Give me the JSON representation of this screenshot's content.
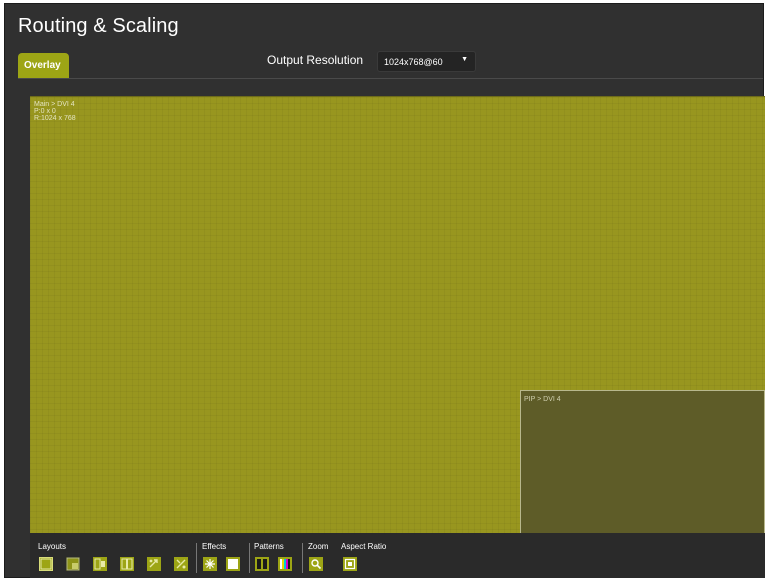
{
  "header": {
    "title": "Routing & Scaling",
    "tab_overlay": "Overlay",
    "output_resolution_label": "Output Resolution",
    "output_resolution_value": "1024x768@60"
  },
  "canvas": {
    "main_window": {
      "source": "Main > DVI 4",
      "position": "P:0 x 0",
      "resolution": "R:1024 x 768"
    },
    "pip_window": {
      "source": "PIP > DVI 4"
    }
  },
  "toolbar": {
    "layouts_label": "Layouts",
    "effects_label": "Effects",
    "patterns_label": "Patterns",
    "zoom_label": "Zoom",
    "aspect_ratio_label": "Aspect Ratio"
  },
  "colors": {
    "accent": "#9da515",
    "canvas": "#98961f",
    "pip": "#5e5c28",
    "panel": "#303030"
  }
}
